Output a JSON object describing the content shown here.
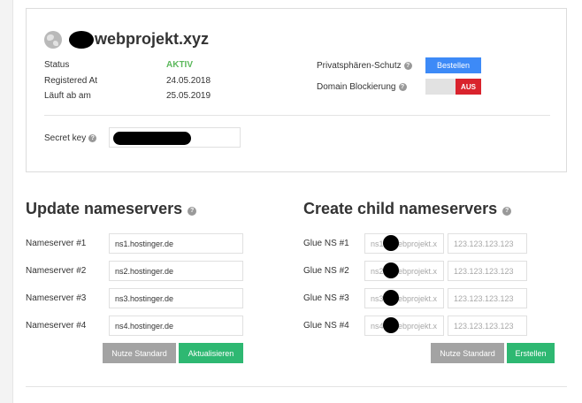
{
  "domain": {
    "title": "webprojekt.xyz",
    "icon": "globe-icon"
  },
  "info": {
    "status_label": "Status",
    "status_value": "AKTIV",
    "registered_label": "Registered At",
    "registered_value": "24.05.2018",
    "expires_label": "Läuft ab am",
    "expires_value": "25.05.2019"
  },
  "privacy": {
    "label": "Privatsphären-Schutz",
    "button": "Bestellen"
  },
  "blocking": {
    "label": "Domain Blockierung",
    "toggle_state": "AUS"
  },
  "secret": {
    "label": "Secret key"
  },
  "update_ns": {
    "title": "Update nameservers",
    "rows": [
      {
        "label": "Nameserver #1",
        "value": "ns1.hostinger.de"
      },
      {
        "label": "Nameserver #2",
        "value": "ns2.hostinger.de"
      },
      {
        "label": "Nameserver #3",
        "value": "ns3.hostinger.de"
      },
      {
        "label": "Nameserver #4",
        "value": "ns4.hostinger.de"
      }
    ],
    "default_button": "Nutze Standard",
    "update_button": "Aktualisieren"
  },
  "child_ns": {
    "title": "Create child nameservers",
    "rows": [
      {
        "label": "Glue NS #1",
        "host_visible": "ns1",
        "host_suffix": "webprojekt.x",
        "ip_placeholder": "123.123.123.123"
      },
      {
        "label": "Glue NS #2",
        "host_visible": "ns2",
        "host_suffix": "webprojekt.x",
        "ip_placeholder": "123.123.123.123"
      },
      {
        "label": "Glue NS #3",
        "host_visible": "ns3",
        "host_suffix": "webprojekt.x",
        "ip_placeholder": "123.123.123.123"
      },
      {
        "label": "Glue NS #4",
        "host_visible": "ns4",
        "host_suffix": "webprojekt.x",
        "ip_placeholder": "123.123.123.123"
      }
    ],
    "default_button": "Nutze Standard",
    "create_button": "Erstellen"
  },
  "colors": {
    "active": "#5cb85c",
    "primary_blue": "#3d8af7",
    "danger_red": "#d9232d",
    "success_green": "#2eb872",
    "neutral_gray": "#a3a3a3"
  }
}
